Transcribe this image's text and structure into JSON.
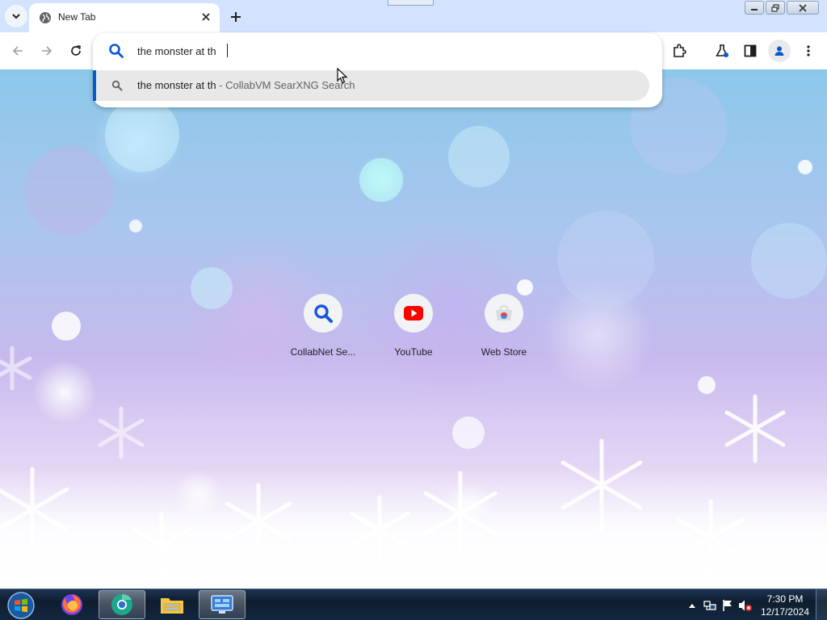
{
  "browser": {
    "tab": {
      "title": "New Tab"
    },
    "tab_search_icon": "chevron-down-icon",
    "new_tab_icon": "plus-icon",
    "window_controls": [
      "minimize",
      "restore",
      "close"
    ],
    "toolbar_icons": [
      "back-arrow-icon",
      "forward-arrow-icon",
      "reload-icon",
      "extensions-puzzle-icon",
      "labs-flask-icon",
      "side-panel-icon",
      "profile-icon",
      "menu-kebab-icon"
    ]
  },
  "omnibox": {
    "input_value": "the monster at th",
    "suggestion": {
      "query": "the monster at th",
      "separator": " - ",
      "description": "CollabVM SearXNG Search"
    }
  },
  "shortcuts": [
    {
      "label": "CollabNet Se...",
      "icon": "magnifier-icon"
    },
    {
      "label": "YouTube",
      "icon": "youtube-play-icon"
    },
    {
      "label": "Web Store",
      "icon": "web-store-icon"
    }
  ],
  "taskbar": {
    "apps": [
      "firefox",
      "chromium-browser",
      "file-explorer",
      "control-panel"
    ],
    "clock": {
      "time": "7:30 PM",
      "date": "12/17/2024"
    }
  },
  "colors": {
    "accent": "#0b57d0",
    "tabstrip": "#d3e3fd",
    "youtube_red": "#ff0000",
    "taskbar": "#1e3451"
  }
}
